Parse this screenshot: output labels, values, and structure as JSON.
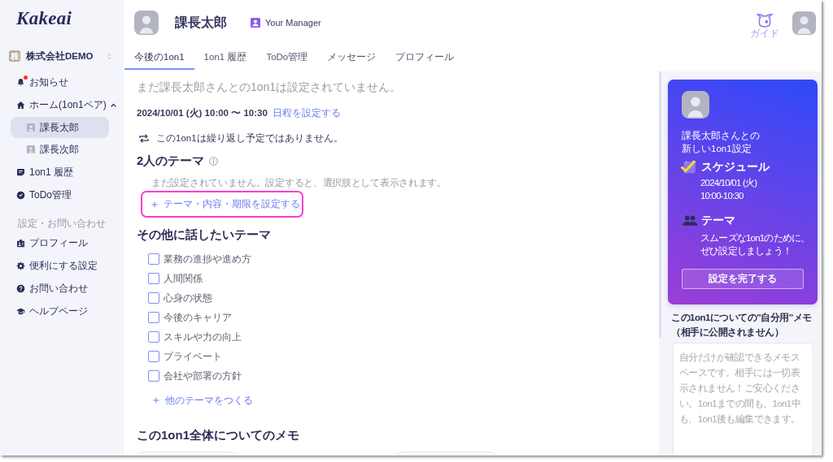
{
  "sidebar": {
    "logo": "Kakeai",
    "company": {
      "badge": "株",
      "name": "株式会社DEMO"
    },
    "nav": [
      {
        "kind": "link",
        "label": "お知らせ",
        "notification": true,
        "selected": false
      },
      {
        "kind": "group",
        "label": "ホーム(1on1ペア)",
        "notification": false,
        "selected": false,
        "expanded": true,
        "children": [
          {
            "label": "課長太郎",
            "selected": true
          },
          {
            "label": "課長次郎",
            "selected": false
          }
        ]
      },
      {
        "kind": "link",
        "label": "1on1 履歴",
        "notification": false,
        "selected": false
      },
      {
        "kind": "link",
        "label": "ToDo管理",
        "notification": false,
        "selected": false
      }
    ],
    "section_label": "設定・お問い合わせ",
    "settings": [
      {
        "label": "プロフィール",
        "selected": false
      },
      {
        "label": "便利にする設定",
        "selected": false
      },
      {
        "label": "お問い合わせ",
        "selected": false
      },
      {
        "label": "ヘルプページ",
        "selected": false
      }
    ]
  },
  "header": {
    "person": {
      "name": "課長太郎",
      "role": "Your Manager"
    },
    "guide": "ガイド"
  },
  "tabs": [
    {
      "label": "今後の1on1",
      "selected": true
    },
    {
      "label": "1on1 履歴",
      "selected": false
    },
    {
      "label": "ToDo管理",
      "selected": false
    },
    {
      "label": "メッセージ",
      "selected": false
    },
    {
      "label": "プロフィール",
      "selected": false
    }
  ],
  "session": {
    "notice": "まだ課長太郎さんとの1on1は設定されていません。",
    "schedule": {
      "datetime": "2024/10/01 (火) 10:00 〜 10:30",
      "link": "日程を設定する"
    },
    "recurrence": "この1on1は繰り返し予定ではありません。",
    "shared_themes": {
      "title": "2人のテーマ",
      "note": "まだ設定されていません。設定すると、選択肢として表示されます。",
      "add_button": {
        "label": "テーマ・内容・期限を設定する",
        "highlighted": true
      }
    },
    "other_themes": {
      "title": "その他に話したいテーマ",
      "options": [
        {
          "label": "業務の進捗や進め方",
          "checked": false
        },
        {
          "label": "人間関係",
          "checked": false
        },
        {
          "label": "心身の状態",
          "checked": false
        },
        {
          "label": "今後のキャリア",
          "checked": false
        },
        {
          "label": "スキルや力の向上",
          "checked": false
        },
        {
          "label": "プライベート",
          "checked": false
        },
        {
          "label": "会社や部署の方針",
          "checked": false
        }
      ],
      "add_link": "他のテーマをつくる"
    },
    "memo": {
      "title": "この1on1全体についてのメモ"
    }
  },
  "side_panel": {
    "setup_card": {
      "title": "課長太郎さんとの新しい1on1設定",
      "steps": [
        {
          "title": "スケジュール",
          "detail": "2024/10/01 (火)\n10:00-10:30",
          "completed": true
        },
        {
          "title": "テーマ",
          "detail": "スムーズな1on1のために、ぜひ設定しましょう！",
          "completed": false
        }
      ],
      "button": "設定を完了する"
    },
    "private_memo": {
      "title": "この1on1についての\"自分用\"メモ（相手に公開されません）",
      "placeholder": "自分だけが確認できるメモスペースです。相手には一切表示されません！ご安心ください。1on1までの間も、1on1中も、1on1後も編集できます。"
    }
  }
}
